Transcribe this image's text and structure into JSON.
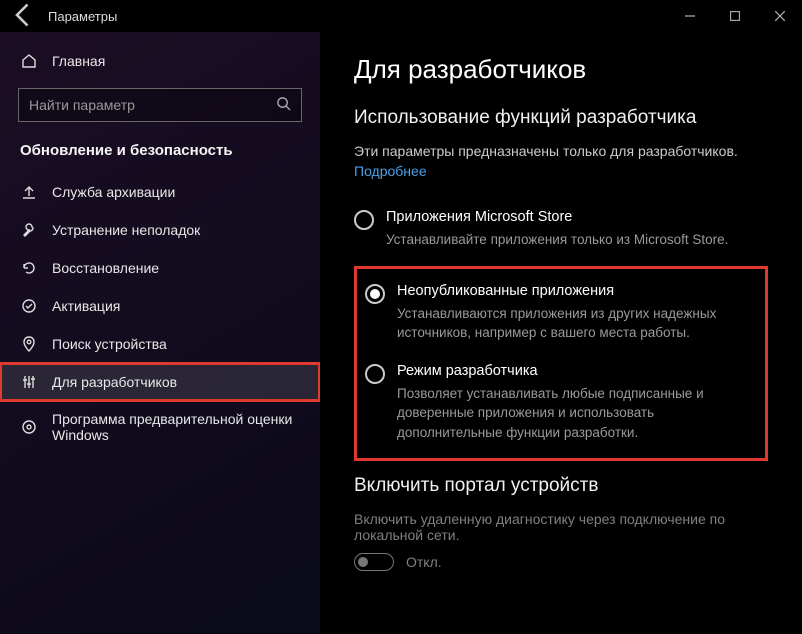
{
  "window": {
    "title": "Параметры"
  },
  "sidebar": {
    "home_label": "Главная",
    "search_placeholder": "Найти параметр",
    "category": "Обновление и безопасность",
    "items": [
      {
        "label": "Служба архивации"
      },
      {
        "label": "Устранение неполадок"
      },
      {
        "label": "Восстановление"
      },
      {
        "label": "Активация"
      },
      {
        "label": "Поиск устройства"
      },
      {
        "label": "Для разработчиков"
      },
      {
        "label": "Программа предварительной оценки Windows"
      }
    ]
  },
  "main": {
    "title": "Для разработчиков",
    "section1_title": "Использование функций разработчика",
    "section1_desc": "Эти параметры предназначены только для разработчиков.",
    "more_link": "Подробнее",
    "options": [
      {
        "label": "Приложения Microsoft Store",
        "sub": "Устанавливайте приложения только из Microsoft Store."
      },
      {
        "label": "Неопубликованные приложения",
        "sub": "Устанавливаются приложения из других надежных источников, например с вашего места работы."
      },
      {
        "label": "Режим разработчика",
        "sub": "Позволяет устанавливать любые подписанные и доверенные приложения и использовать дополнительные функции разработки."
      }
    ],
    "section2_title": "Включить портал устройств",
    "section2_desc": "Включить удаленную диагностику через подключение по локальной сети.",
    "toggle_off": "Откл."
  }
}
